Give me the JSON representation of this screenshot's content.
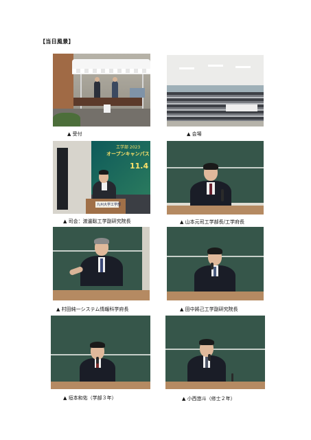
{
  "heading": "【当日風景】",
  "captions": [
    "▲ 受付",
    "▲ 会場",
    "▲ 司会：渡邊聡工学副研究院長",
    "▲ 山本元司工学部長/工学府長",
    "▲ 村田純一システム情報科学府長",
    "▲ 田中將己工学副研究院長",
    "▲ 垣本和佑（学部３年）",
    "▲ 小西悠斗（修士２年）"
  ],
  "photo_text": {
    "banner_top": "工学部 2023",
    "banner_title": "オープンキャンパス",
    "banner_date": "11.4",
    "podium_label": "九州大学工学部"
  }
}
